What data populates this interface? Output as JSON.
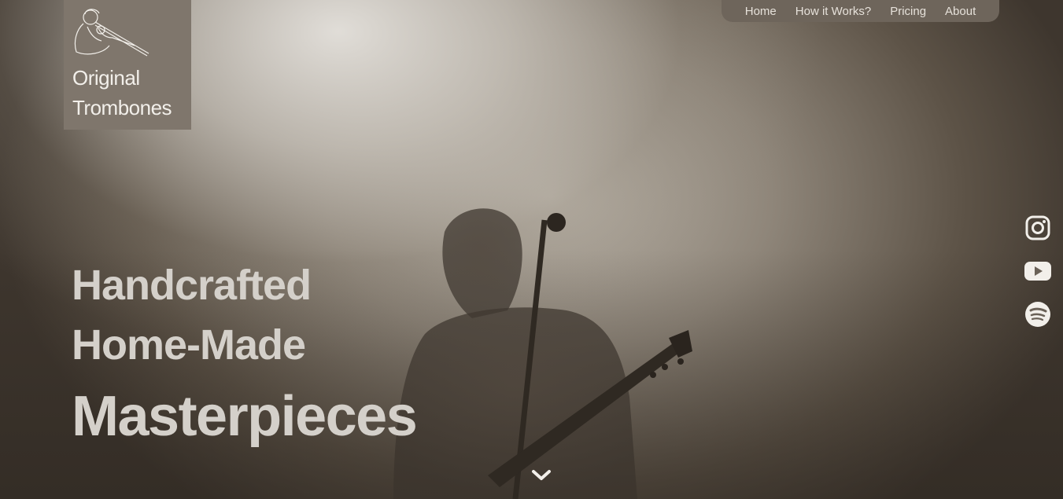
{
  "brand": {
    "line1": "Original",
    "line2": "Trombones",
    "logo_icon": "trombone-player-icon"
  },
  "nav": {
    "items": [
      "Home",
      "How it Works?",
      "Pricing",
      "About"
    ]
  },
  "hero": {
    "line1": "Handcrafted",
    "line2": "Home-Made",
    "line3": "Masterpieces"
  },
  "social": [
    "instagram-icon",
    "youtube-icon",
    "spotify-icon"
  ],
  "scroll_icon": "chevron-down-icon",
  "colors": {
    "logo_bg": "#7f766c",
    "nav_bg": "#6e655b",
    "text_light": "#d4d0ca"
  }
}
